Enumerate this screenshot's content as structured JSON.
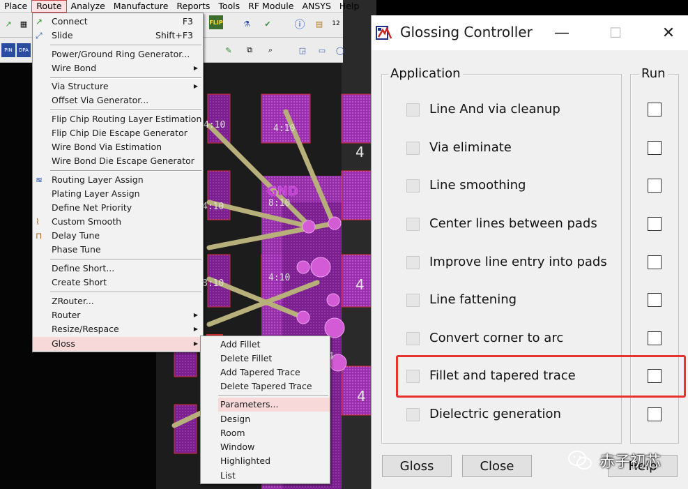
{
  "menubar": {
    "items": [
      "Place",
      "Route",
      "Analyze",
      "Manufacture",
      "Reports",
      "Tools",
      "RF Module",
      "ANSYS",
      "Help"
    ],
    "active": "Route"
  },
  "toolbar": {
    "labels": [
      "FLIP"
    ]
  },
  "pcb": {
    "pad_labels": [
      "4:10",
      "8:10",
      "4:10",
      "4:10",
      "4:10",
      "8:10"
    ],
    "net_label": "GND",
    "side_labels": [
      "4",
      "4",
      "4",
      "4"
    ]
  },
  "route_menu": {
    "items": [
      {
        "label": "Connect",
        "shortcut": "F3"
      },
      {
        "label": "Slide",
        "shortcut": "Shift+F3"
      },
      {
        "label": "Power/Ground Ring Generator..."
      },
      {
        "label": "Wire Bond"
      },
      {
        "label": "Via Structure"
      },
      {
        "label": "Offset Via Generator..."
      },
      {
        "label": "Flip Chip Routing Layer Estimation"
      },
      {
        "label": "Flip Chip Die Escape Generator"
      },
      {
        "label": "Wire Bond Via Estimation"
      },
      {
        "label": "Wire Bond Die Escape Generator"
      },
      {
        "label": "Routing Layer Assign"
      },
      {
        "label": "Plating Layer Assign"
      },
      {
        "label": "Define Net Priority"
      },
      {
        "label": "Custom Smooth"
      },
      {
        "label": "Delay Tune"
      },
      {
        "label": "Phase Tune"
      },
      {
        "label": "Define Short..."
      },
      {
        "label": "Create Short"
      },
      {
        "label": "ZRouter..."
      },
      {
        "label": "Router"
      },
      {
        "label": "Resize/Respace"
      },
      {
        "label": "Gloss"
      }
    ]
  },
  "gloss_menu": {
    "items": [
      "Add Fillet",
      "Delete Fillet",
      "Add Tapered Trace",
      "Delete Tapered Trace",
      "Parameters...",
      "Design",
      "Room",
      "Window",
      "Highlighted",
      "List"
    ]
  },
  "dialog": {
    "title": "Glossing Controller",
    "minimize": "—",
    "maximize": "☐",
    "close": "✕",
    "group_application": "Application",
    "group_run": "Run",
    "rows": [
      "Line And via cleanup",
      "Via eliminate",
      "Line smoothing",
      "Center lines between pads",
      "Improve line entry into pads",
      "Line fattening",
      "Convert corner to arc",
      "Fillet and tapered trace",
      "Dielectric generation"
    ],
    "buttons": {
      "gloss": "Gloss",
      "close": "Close",
      "help": "Help"
    }
  },
  "watermark": {
    "text": "赤子初芯"
  },
  "colors": {
    "highlight_box": "#e8322e",
    "pad_magenta": "#b23cc9",
    "trace_olive": "#b8b07a"
  }
}
